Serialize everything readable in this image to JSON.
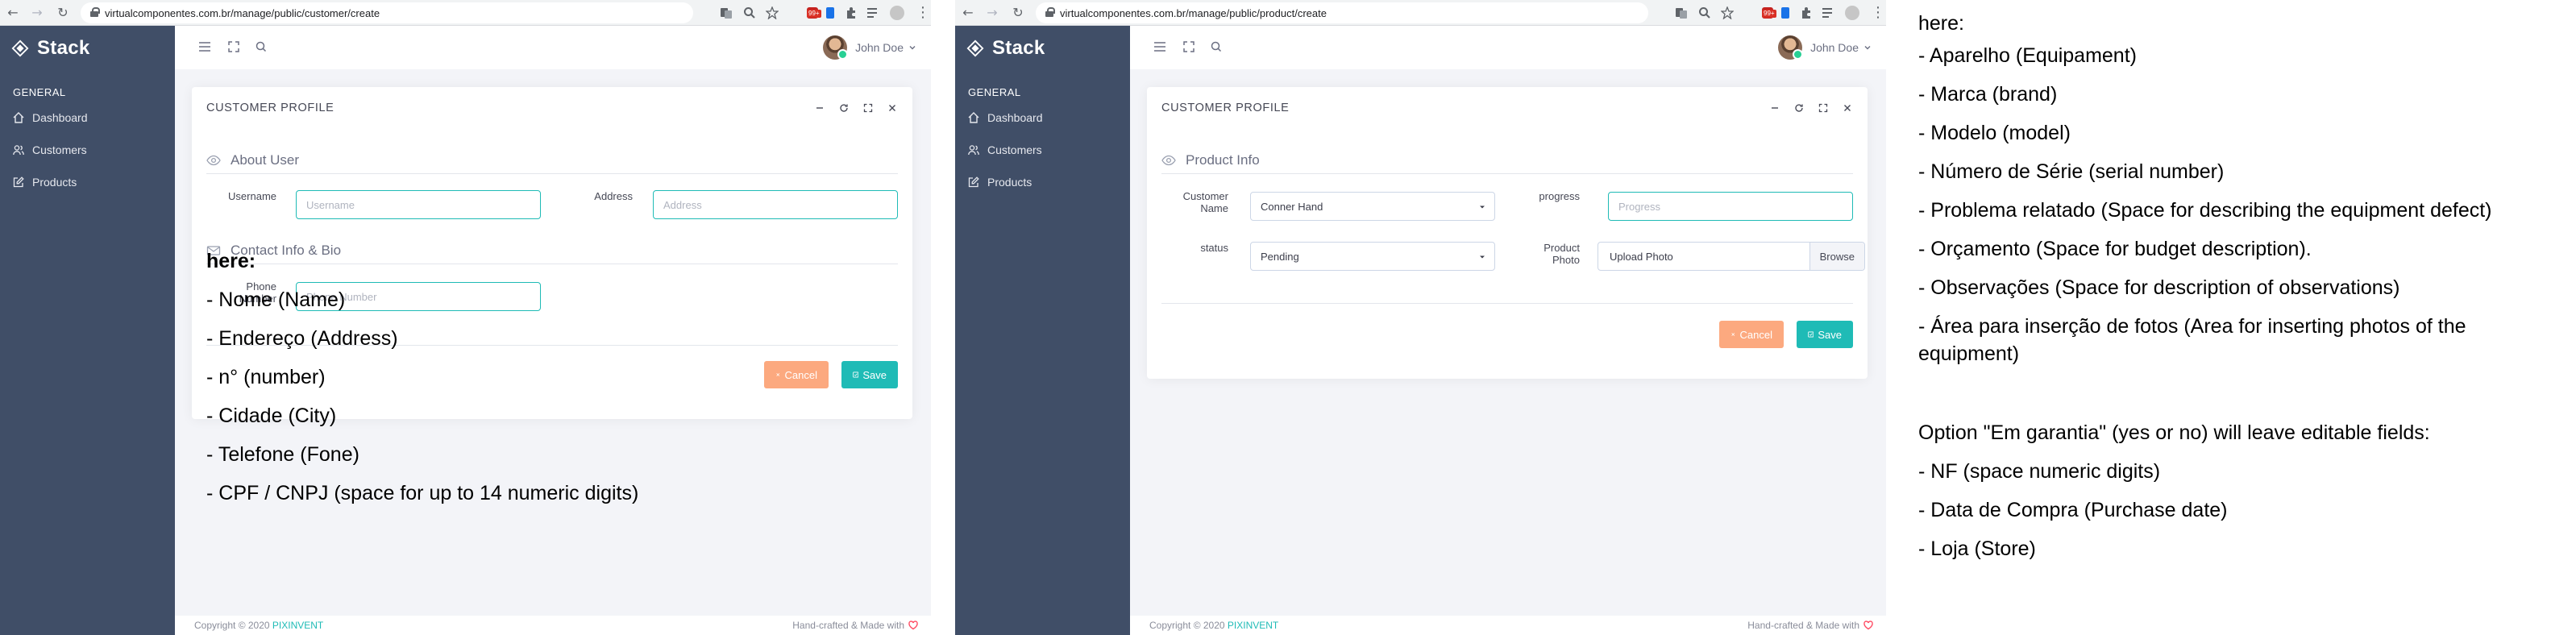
{
  "left_window": {
    "url": "virtualcomponentes.com.br/manage/public/customer/create",
    "ext_badge": "99+",
    "brand": "Stack",
    "nav_heading": "GENERAL",
    "nav_items": [
      "Dashboard",
      "Customers",
      "Products"
    ],
    "user_name": "John Doe",
    "card_title": "CUSTOMER PROFILE",
    "section_1": "About User",
    "section_2": "Contact Info & Bio",
    "fields": {
      "username_label": "Username",
      "username_placeholder": "Username",
      "address_label": "Address",
      "address_placeholder": "Address",
      "phone_label": "Phone Number",
      "phone_placeholder": "Phone Number"
    },
    "cancel_label": "Cancel",
    "save_label": "Save",
    "footer_copy_prefix": "Copyright © 2020",
    "footer_brand": "PIXINVENT",
    "footer_credit": "Hand-crafted & Made with",
    "notes": [
      "here:",
      "- Nome (Name)",
      "- Endereço (Address)",
      "- n° (number)",
      "- Cidade (City)",
      "- Telefone (Fone)",
      "- CPF / CNPJ (space for up to 14 numeric digits)"
    ]
  },
  "right_window": {
    "url": "virtualcomponentes.com.br/manage/public/product/create",
    "ext_badge": "99+",
    "brand": "Stack",
    "nav_heading": "GENERAL",
    "nav_items": [
      "Dashboard",
      "Customers",
      "Products"
    ],
    "user_name": "John Doe",
    "card_title": "CUSTOMER PROFILE",
    "section_1": "Product Info",
    "fields": {
      "customer_label": "Customer Name",
      "customer_value": "Conner Hand",
      "progress_label": "progress",
      "progress_placeholder": "Progress",
      "status_label": "status",
      "status_value": "Pending",
      "photo_label": "Product Photo",
      "photo_value": "Upload Photo",
      "browse_label": "Browse"
    },
    "cancel_label": "Cancel",
    "save_label": "Save",
    "footer_copy_prefix": "Copyright © 2020",
    "footer_brand": "PIXINVENT",
    "footer_credit": "Hand-crafted & Made with"
  },
  "side_notes": [
    "here:",
    "- Aparelho  (Equipament)",
    "- Marca (brand)",
    "- Modelo (model)",
    "- Número de Série (serial number)",
    "- Problema relatado (Space for describing the equipment defect)",
    "- Orçamento (Space for budget description).",
    "- Observações (Space for description of observations)",
    "- Área para inserção de fotos (Area for inserting photos of the",
    "equipment)",
    "Option \"Em garantia\" (yes or no) will leave editable fields:",
    "- NF (space numeric digits)",
    "- Data de Compra (Purchase date)",
    "- Loja (Store)"
  ],
  "colors": {
    "sidebar": "#404e67",
    "accent": "#1fbbb6",
    "cancel": "#fca97f",
    "heart": "#ff4961"
  }
}
